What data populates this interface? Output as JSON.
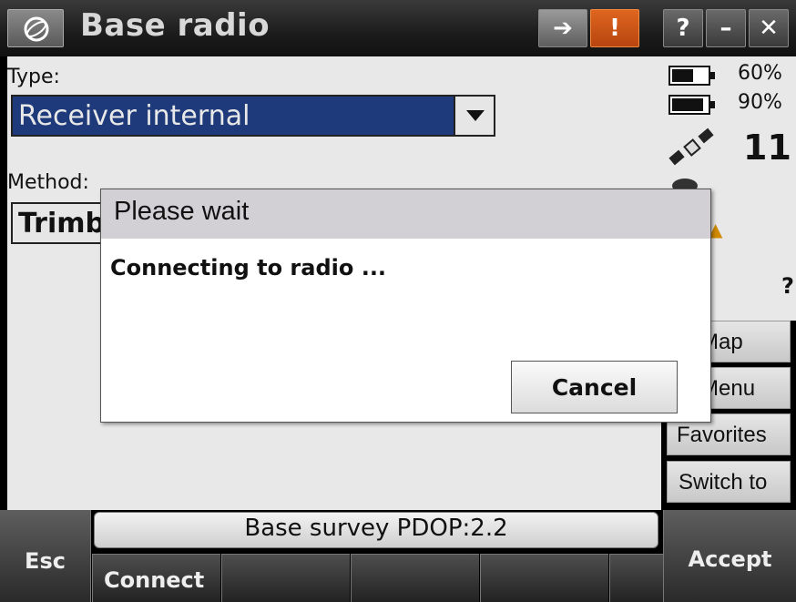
{
  "titlebar": {
    "title": "Base radio",
    "help_label": "?",
    "minimize_label": "–",
    "close_label": "✕",
    "alert_label": "!",
    "alert_color": "#d4571a"
  },
  "form": {
    "type_label": "Type:",
    "type_value": "Receiver internal",
    "method_label": "Method:",
    "method_value": "Trimble"
  },
  "status": {
    "battery1_percent": "60%",
    "battery1_level": 0.6,
    "battery2_percent": "90%",
    "battery2_level": 0.9,
    "satellite_count": "11",
    "unknown_indicator": "?"
  },
  "side_buttons": {
    "map": "Map",
    "menu": "Menu",
    "favorites": "Favorites",
    "switch_to": "Switch to"
  },
  "statusbar": {
    "text": "Base survey  PDOP:2.2"
  },
  "bottom": {
    "esc_label": "Esc",
    "accept_label": "Accept",
    "softkeys": [
      "Connect",
      "",
      "",
      "",
      ""
    ]
  },
  "modal": {
    "title": "Please wait",
    "message": "Connecting to radio ...",
    "cancel_label": "Cancel"
  }
}
